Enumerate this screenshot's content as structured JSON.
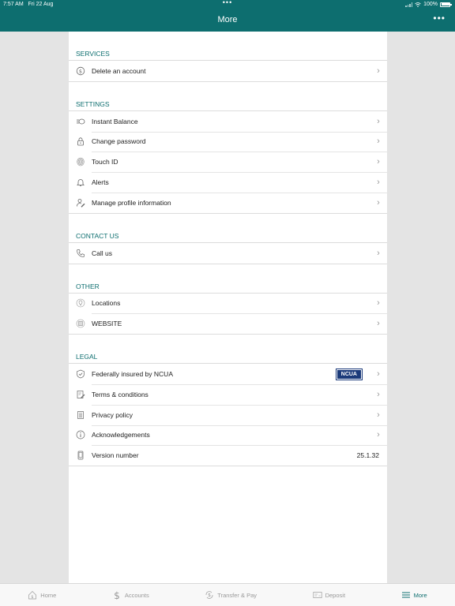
{
  "status_bar": {
    "time": "7:57 AM",
    "date": "Fri 22 Aug",
    "dots": "•••",
    "battery": "100%"
  },
  "nav": {
    "title": "More",
    "more_icon": "ellipsis-icon"
  },
  "sections": {
    "services": {
      "header": "SERVICES",
      "items": [
        {
          "label": "Delete an account",
          "icon": "dollar-refresh-icon"
        }
      ]
    },
    "settings": {
      "header": "SETTINGS",
      "items": [
        {
          "label": "Instant Balance",
          "icon": "coins-icon"
        },
        {
          "label": "Change password",
          "icon": "lock-icon"
        },
        {
          "label": "Touch ID",
          "icon": "fingerprint-icon"
        },
        {
          "label": "Alerts",
          "icon": "bell-icon"
        },
        {
          "label": "Manage profile information",
          "icon": "user-edit-icon"
        }
      ]
    },
    "contact": {
      "header": "CONTACT US",
      "items": [
        {
          "label": "Call us",
          "icon": "phone-icon"
        }
      ]
    },
    "other": {
      "header": "OTHER",
      "items": [
        {
          "label": "Locations",
          "icon": "location-pin-icon"
        },
        {
          "label": "WEBSITE",
          "icon": "globe-icon"
        }
      ]
    },
    "legal": {
      "header": "LEGAL",
      "items": [
        {
          "label": "Federally insured by NCUA",
          "icon": "shield-check-icon",
          "badge": "NCUA"
        },
        {
          "label": "Terms & conditions",
          "icon": "document-edit-icon"
        },
        {
          "label": "Privacy policy",
          "icon": "document-list-icon"
        },
        {
          "label": "Acknowledgements",
          "icon": "info-icon"
        },
        {
          "label": "Version number",
          "icon": "tablet-icon",
          "value": "25.1.32"
        }
      ]
    }
  },
  "tabs": [
    {
      "label": "Home",
      "icon": "home-dollar-icon"
    },
    {
      "label": "Accounts",
      "icon": "dollar-icon"
    },
    {
      "label": "Transfer & Pay",
      "icon": "transfer-dollar-icon"
    },
    {
      "label": "Deposit",
      "icon": "check-deposit-icon"
    },
    {
      "label": "More",
      "icon": "menu-icon",
      "active": true
    }
  ],
  "colors": {
    "primary": "#0d6e6f",
    "background": "#e4e4e4",
    "badge": "#1b3a7a"
  }
}
